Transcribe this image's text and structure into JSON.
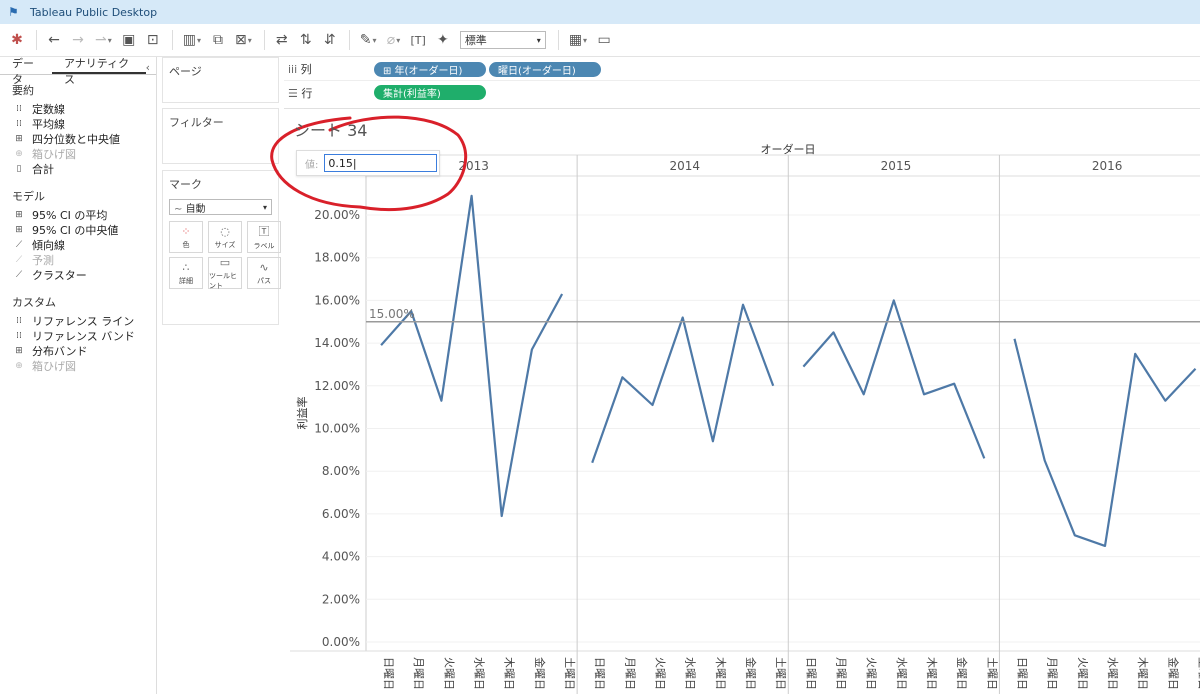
{
  "window": {
    "title": "Tableau Public Desktop"
  },
  "toolbar": {
    "buttons": [
      "tableau-logo-icon",
      "undo-icon",
      "redo-icon",
      "replay-icon",
      "save-icon",
      "add-datasource-icon",
      "new-worksheet-icon",
      "duplicate-icon",
      "clear-sheet-icon",
      "swap-icon",
      "sort-asc-icon",
      "sort-desc-icon",
      "highlight-icon",
      "group-icon",
      "label-icon",
      "pin-icon",
      "show-me-icon",
      "presentation-icon"
    ],
    "fit_select": "標準"
  },
  "left_panel": {
    "tabs": {
      "data": "データ",
      "analytics": "アナリティクス"
    },
    "sections": [
      {
        "title": "要約",
        "items": [
          {
            "label": "定数線",
            "icon": "constant-line-icon",
            "disabled": false
          },
          {
            "label": "平均線",
            "icon": "average-line-icon",
            "disabled": false
          },
          {
            "label": "四分位数と中央値",
            "icon": "box-icon",
            "disabled": false
          },
          {
            "label": "箱ひげ図",
            "icon": "boxplot-icon",
            "disabled": true
          },
          {
            "label": "合計",
            "icon": "totals-icon",
            "disabled": false
          }
        ]
      },
      {
        "title": "モデル",
        "items": [
          {
            "label": "95% CI の平均",
            "icon": "ci-mean-icon",
            "disabled": false
          },
          {
            "label": "95% CI の中央値",
            "icon": "ci-median-icon",
            "disabled": false
          },
          {
            "label": "傾向線",
            "icon": "trend-line-icon",
            "disabled": false
          },
          {
            "label": "予測",
            "icon": "forecast-icon",
            "disabled": true
          },
          {
            "label": "クラスター",
            "icon": "cluster-icon",
            "disabled": false
          }
        ]
      },
      {
        "title": "カスタム",
        "items": [
          {
            "label": "リファレンス ライン",
            "icon": "ref-line-icon",
            "disabled": false
          },
          {
            "label": "リファレンス バンド",
            "icon": "ref-band-icon",
            "disabled": false
          },
          {
            "label": "分布バンド",
            "icon": "dist-band-icon",
            "disabled": false
          },
          {
            "label": "箱ひげ図",
            "icon": "boxplot-icon",
            "disabled": true
          }
        ]
      }
    ]
  },
  "shelves": {
    "pages": "ページ",
    "filters": "フィルター",
    "marks": {
      "title": "マーク",
      "type": "自動",
      "buttons": [
        "色",
        "サイズ",
        "ラベル",
        "詳細",
        "ツールヒント",
        "パス"
      ]
    },
    "columns_label": "列",
    "rows_label": "行",
    "column_pills": [
      "⊞ 年(オーダー日)",
      "曜日(オーダー日)"
    ],
    "row_pills": [
      "集計(利益率)"
    ]
  },
  "sheet": {
    "title": "シート 34"
  },
  "parameter": {
    "label": "値:",
    "value": "0.15"
  },
  "chart_data": {
    "type": "line",
    "title": "",
    "header": "オーダー日",
    "ylabel": "利益率",
    "ylim": [
      0,
      0.21
    ],
    "yticks": [
      0,
      0.02,
      0.04,
      0.06,
      0.08,
      0.1,
      0.12,
      0.14,
      0.16,
      0.18,
      0.2
    ],
    "ytick_labels": [
      "0.00%",
      "2.00%",
      "4.00%",
      "6.00%",
      "8.00%",
      "10.00%",
      "12.00%",
      "14.00%",
      "16.00%",
      "18.00%",
      "20.00%"
    ],
    "reference_line": {
      "value": 0.15,
      "label": "15.00%"
    },
    "categories": [
      "日曜日",
      "月曜日",
      "火曜日",
      "水曜日",
      "木曜日",
      "金曜日",
      "土曜日"
    ],
    "panes": [
      {
        "year": "2013",
        "values": [
          0.139,
          0.155,
          0.113,
          0.209,
          0.059,
          0.137,
          0.163
        ]
      },
      {
        "year": "2014",
        "values": [
          0.084,
          0.124,
          0.111,
          0.152,
          0.094,
          0.158,
          0.12
        ]
      },
      {
        "year": "2015",
        "values": [
          0.129,
          0.145,
          0.116,
          0.16,
          0.116,
          0.121,
          0.086
        ]
      },
      {
        "year": "2016",
        "values": [
          0.142,
          0.085,
          0.05,
          0.045,
          0.135,
          0.113,
          0.128
        ]
      }
    ],
    "grid": true,
    "line_color": "#4e79a7",
    "annotation_color": "#d9202a"
  }
}
